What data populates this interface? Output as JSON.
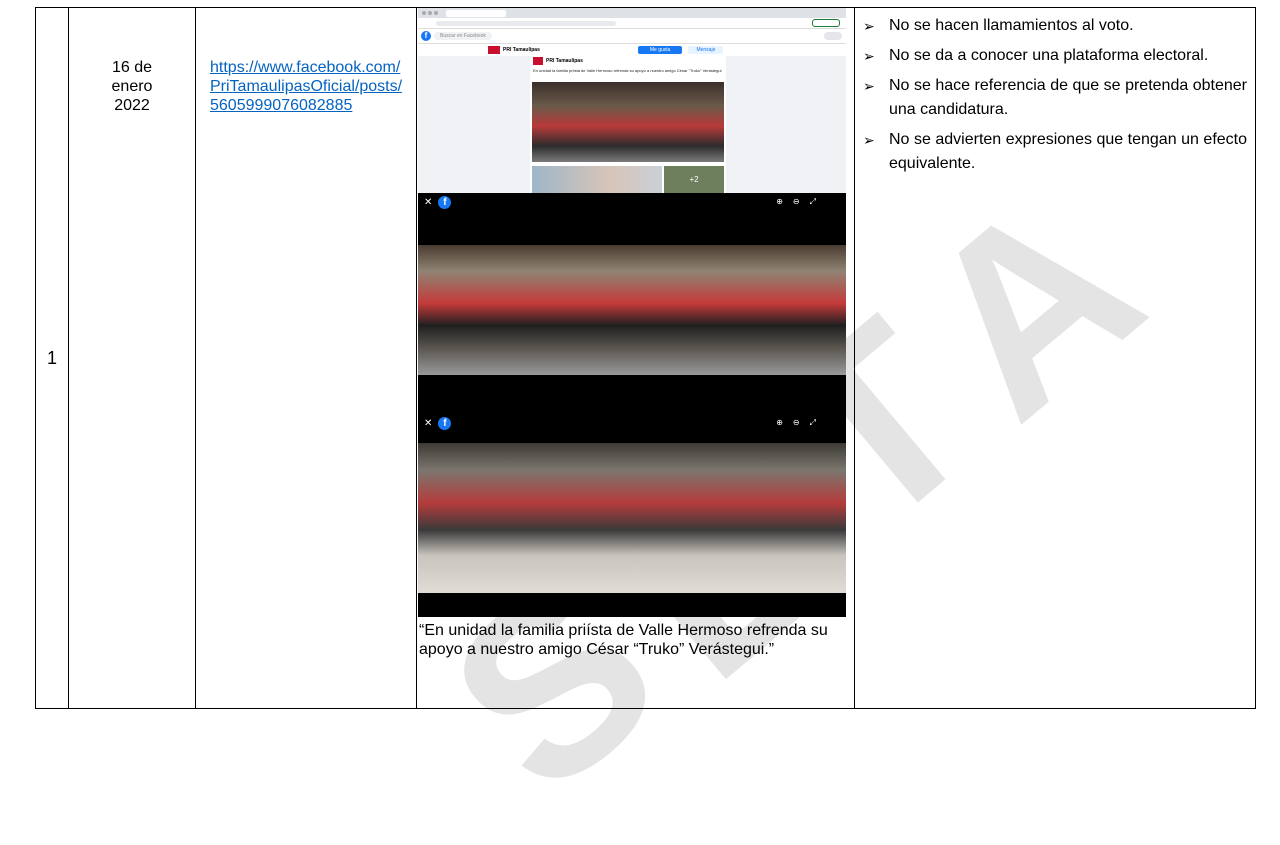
{
  "row": {
    "number": "1",
    "date_lines": [
      "16 de",
      "enero",
      "2022"
    ],
    "link_text": "https://www.facebook.com/PriTamaulipasOficial/posts/5605999076082885",
    "caption": "“En unidad la familia priísta de Valle Hermoso refrenda su apoyo a nuestro amigo César “Truko” Verástegui.”",
    "analysis": [
      "No se hacen llamamientos al voto.",
      "No se da a conocer una plataforma electoral.",
      "No se hace referencia de que se pretenda obtener una candidatura.",
      "No se advierten expresiones que tengan un efecto equivalente."
    ]
  },
  "screenshot_1": {
    "search_placeholder": "Buscar en Facebook",
    "page_name": "PRI Tamaulipas",
    "post_text": "En unidad la familia priísta de Valle Hermoso refrenda su apoyo a nuestro amigo César \"Truko\" Verástegui",
    "more_photos": "+2",
    "like_button": "Me gusta",
    "message_button": "Mensaje"
  },
  "watermark_text": "CONSULTA",
  "colors": {
    "link": "#0563c1",
    "facebook_blue": "#1877f2",
    "watermark": "#e4e4e4"
  }
}
